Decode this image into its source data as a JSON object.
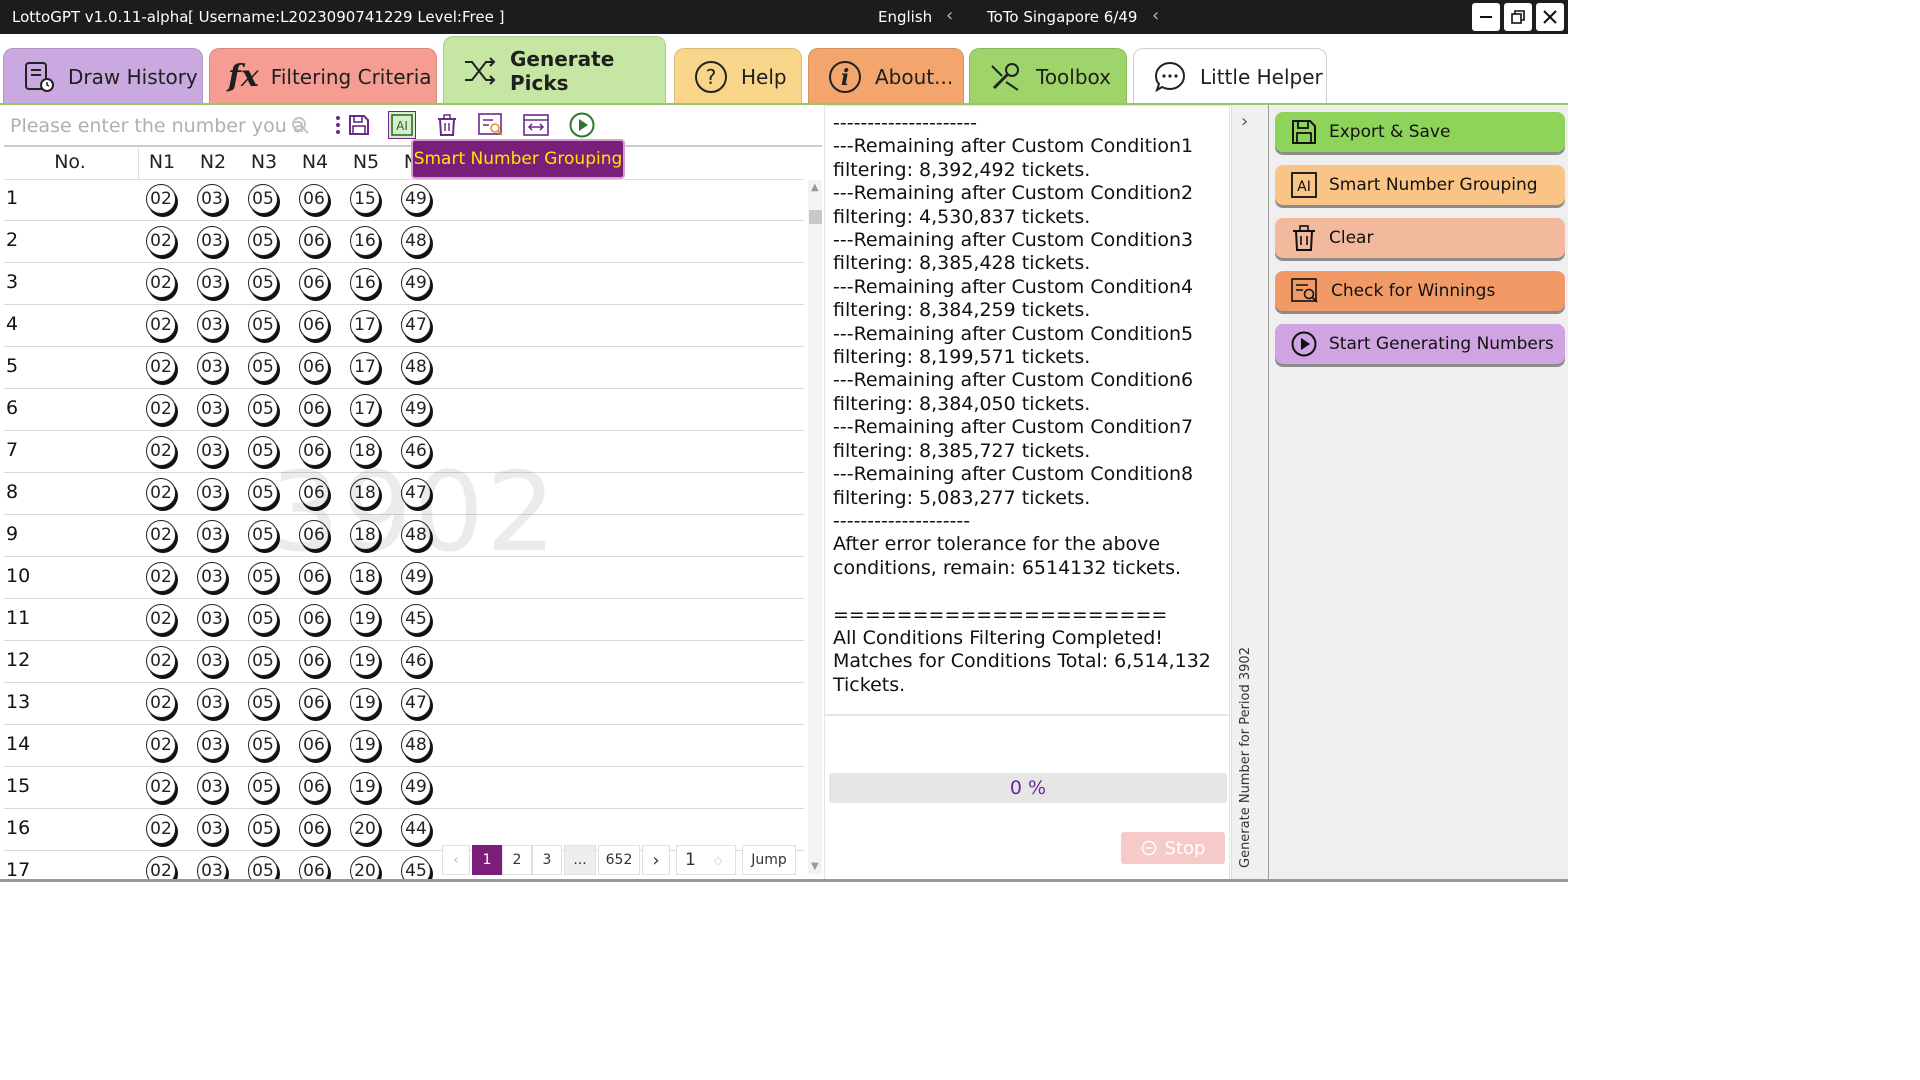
{
  "titlebar": {
    "app": "LottoGPT v1.0.11-alpha",
    "user_info": "[ Username:L2023090741229  Level:Free ]",
    "language": "English",
    "lottery": "ToTo Singapore 6/49"
  },
  "tabs": [
    {
      "label": "Draw History",
      "color": "#c9a9df"
    },
    {
      "label": "Filtering Criteria",
      "color": "#f59c93"
    },
    {
      "label": "Generate Picks",
      "color": "#c6e6a3"
    },
    {
      "label": "Help",
      "color": "#f9d58a"
    },
    {
      "label": "About...",
      "color": "#f2a56d"
    },
    {
      "label": "Toolbox",
      "color": "#9fd46b"
    },
    {
      "label": "Little Helper",
      "color": "#ffffff"
    }
  ],
  "search": {
    "placeholder": "Please enter the number you a"
  },
  "tooltip": "Smart Number Grouping",
  "table": {
    "headers": [
      "No.",
      "N1",
      "N2",
      "N3",
      "N4",
      "N5",
      "N6"
    ],
    "rows": [
      {
        "no": "1",
        "n": [
          "02",
          "03",
          "05",
          "06",
          "15",
          "49"
        ]
      },
      {
        "no": "2",
        "n": [
          "02",
          "03",
          "05",
          "06",
          "16",
          "48"
        ]
      },
      {
        "no": "3",
        "n": [
          "02",
          "03",
          "05",
          "06",
          "16",
          "49"
        ]
      },
      {
        "no": "4",
        "n": [
          "02",
          "03",
          "05",
          "06",
          "17",
          "47"
        ]
      },
      {
        "no": "5",
        "n": [
          "02",
          "03",
          "05",
          "06",
          "17",
          "48"
        ]
      },
      {
        "no": "6",
        "n": [
          "02",
          "03",
          "05",
          "06",
          "17",
          "49"
        ]
      },
      {
        "no": "7",
        "n": [
          "02",
          "03",
          "05",
          "06",
          "18",
          "46"
        ]
      },
      {
        "no": "8",
        "n": [
          "02",
          "03",
          "05",
          "06",
          "18",
          "47"
        ]
      },
      {
        "no": "9",
        "n": [
          "02",
          "03",
          "05",
          "06",
          "18",
          "48"
        ]
      },
      {
        "no": "10",
        "n": [
          "02",
          "03",
          "05",
          "06",
          "18",
          "49"
        ]
      },
      {
        "no": "11",
        "n": [
          "02",
          "03",
          "05",
          "06",
          "19",
          "45"
        ]
      },
      {
        "no": "12",
        "n": [
          "02",
          "03",
          "05",
          "06",
          "19",
          "46"
        ]
      },
      {
        "no": "13",
        "n": [
          "02",
          "03",
          "05",
          "06",
          "19",
          "47"
        ]
      },
      {
        "no": "14",
        "n": [
          "02",
          "03",
          "05",
          "06",
          "19",
          "48"
        ]
      },
      {
        "no": "15",
        "n": [
          "02",
          "03",
          "05",
          "06",
          "19",
          "49"
        ]
      },
      {
        "no": "16",
        "n": [
          "02",
          "03",
          "05",
          "06",
          "20",
          "44"
        ]
      },
      {
        "no": "17",
        "n": [
          "02",
          "03",
          "05",
          "06",
          "20",
          "45"
        ]
      }
    ]
  },
  "watermark": "3902",
  "pagination": {
    "pages": [
      "1",
      "2",
      "3",
      "...",
      "652"
    ],
    "current": "1",
    "jump_value": "1",
    "jump_label": "Jump"
  },
  "log": [
    "---------------------",
    "---Remaining after Custom Condition1",
    "filtering: 8,392,492 tickets.",
    "---Remaining after Custom Condition2",
    "filtering: 4,530,837 tickets.",
    "---Remaining after Custom Condition3",
    "filtering: 8,385,428 tickets.",
    "---Remaining after Custom Condition4",
    "filtering: 8,384,259 tickets.",
    "---Remaining after Custom Condition5",
    "filtering: 8,199,571 tickets.",
    "---Remaining after Custom Condition6",
    "filtering: 8,384,050 tickets.",
    "---Remaining after Custom Condition7",
    "filtering: 8,385,727 tickets.",
    "---Remaining after Custom Condition8",
    "filtering: 5,083,277 tickets.",
    "--------------------",
    "After error tolerance for the above",
    "conditions, remain: 6514132 tickets.",
    "",
    "=====================",
    "All Conditions Filtering Completed!",
    "Matches for Conditions Total: 6,514,132",
    "Tickets."
  ],
  "progress": {
    "text": "0 %",
    "value": 0
  },
  "stop_label": "Stop",
  "vertical_label": "Generate Number for Period 3902",
  "actions": [
    {
      "label": "Export & Save",
      "color": "#8fd45a",
      "icon": "save-icon"
    },
    {
      "label": "Smart Number Grouping",
      "color": "#fac487",
      "icon": "ai-icon"
    },
    {
      "label": "Clear",
      "color": "#f2b99d",
      "icon": "trash-icon"
    },
    {
      "label": "Check for Winnings",
      "color": "#f29a66",
      "icon": "check-winnings-icon"
    },
    {
      "label": "Start Generating Numbers",
      "color": "#d0a3e3",
      "icon": "play-icon"
    }
  ]
}
